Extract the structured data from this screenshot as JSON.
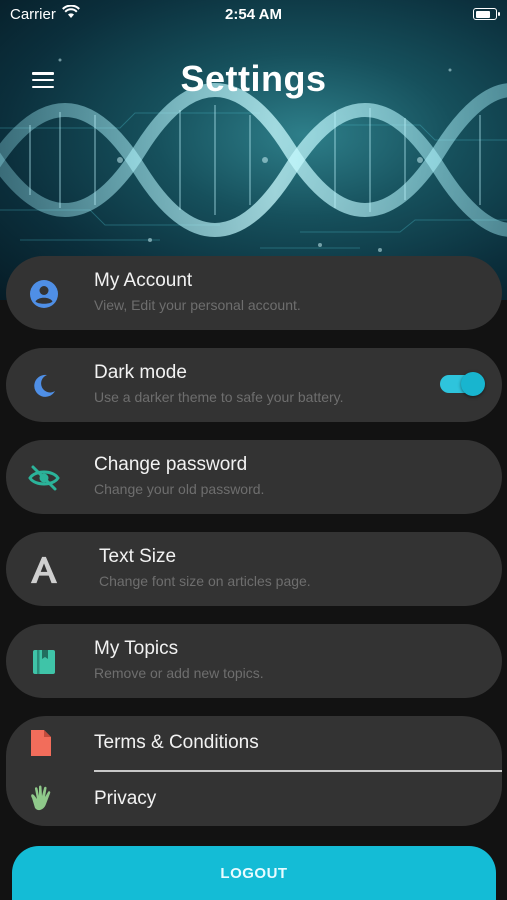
{
  "status_bar": {
    "carrier": "Carrier",
    "time": "2:54 AM"
  },
  "header": {
    "title": "Settings"
  },
  "settings": [
    {
      "title": "My Account",
      "subtitle": "View, Edit your personal account.",
      "icon": "account-circle-icon",
      "icon_color": "#4f8fe6"
    },
    {
      "title": "Dark mode",
      "subtitle": "Use a darker theme to safe your battery.",
      "icon": "moon-icon",
      "icon_color": "#4f8fe6",
      "toggle_on": true
    },
    {
      "title": "Change password",
      "subtitle": "Change your old password.",
      "icon": "eye-off-icon",
      "icon_color": "#2bb39a"
    },
    {
      "title": "Text Size",
      "subtitle": "Change font size on articles page.",
      "icon": "text-size-icon",
      "icon_color": "#cfcfcf"
    },
    {
      "title": "My Topics",
      "subtitle": "Remove or add new topics.",
      "icon": "book-icon",
      "icon_color": "#3fc4a8"
    }
  ],
  "legal": [
    {
      "title": "Terms & Conditions",
      "icon": "document-icon",
      "icon_color": "#f26d5b"
    },
    {
      "title": "Privacy",
      "icon": "hand-icon",
      "icon_color": "#8fc98a"
    }
  ],
  "logout_label": "LOGOUT",
  "colors": {
    "accent": "#14bcd6",
    "card": "#333333",
    "background": "#121212"
  }
}
